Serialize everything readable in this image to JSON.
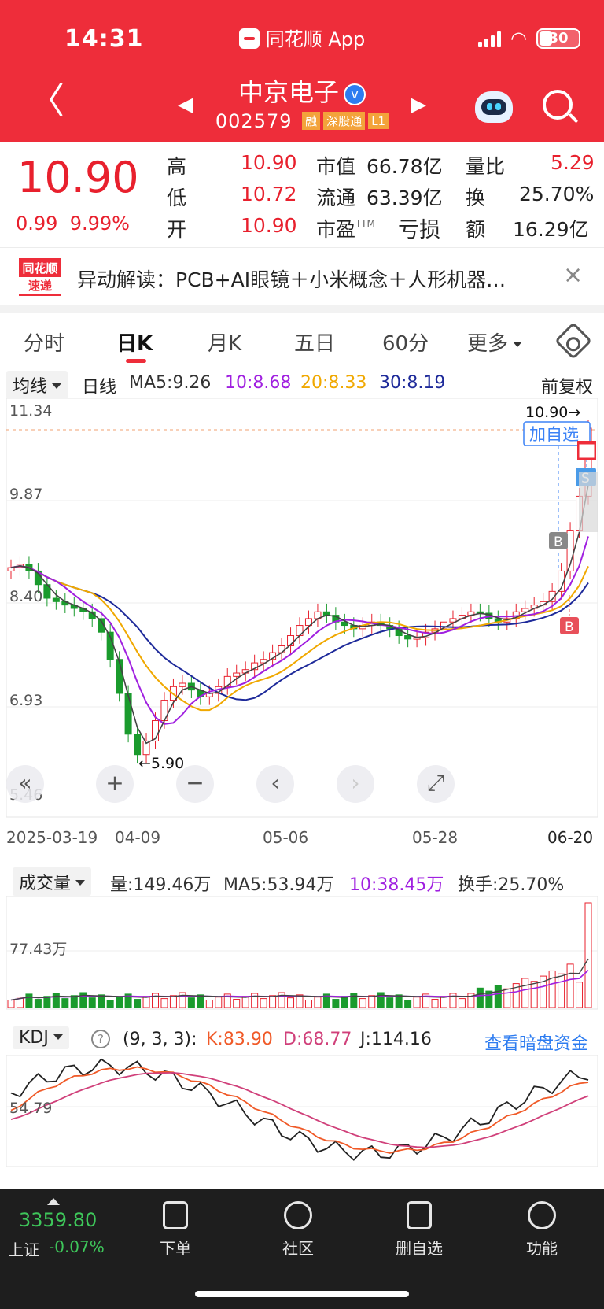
{
  "status": {
    "time": "14:31",
    "app": "同花顺 App",
    "battery": "30"
  },
  "header": {
    "name": "中京电子",
    "verified_mark": "v",
    "code": "002579",
    "tags": [
      "融",
      "深股通",
      "L1"
    ]
  },
  "quote": {
    "price": "10.90",
    "change": "0.99",
    "change_pct": "9.99%",
    "high_label": "高",
    "high": "10.90",
    "low_label": "低",
    "low": "10.72",
    "open_label": "开",
    "open": "10.90",
    "mktcap_label": "市值",
    "mktcap": "66.78亿",
    "float_label": "流通",
    "float": "63.39亿",
    "pe_label": "市盈",
    "pe_sup": "TTM",
    "pe": "亏损",
    "volratio_label": "量比",
    "volratio": "5.29",
    "turnover_label": "换",
    "turnover": "25.70%",
    "amount_label": "额",
    "amount": "16.29亿"
  },
  "news": {
    "badge_top": "同花顺",
    "badge_bottom": "速递",
    "text": "异动解读：PCB+AI眼镜＋小米概念＋人形机器…",
    "close": "×"
  },
  "tabs": [
    "分时",
    "日K",
    "月K",
    "五日",
    "60分",
    "更多"
  ],
  "ma_legend": {
    "selector": "均线",
    "period": "日线",
    "ma5": "MA5:9.26",
    "ma10": "10:8.68",
    "ma20": "20:8.33",
    "ma30": "30:8.19",
    "adjust": "前复权"
  },
  "kline": {
    "y_labels": [
      "11.34",
      "9.87",
      "8.40",
      "6.93",
      "5.46"
    ],
    "last_price_label": "10.90→",
    "add_watch": "加自选",
    "low_marker": "←5.90",
    "dates": [
      "2025-03-19",
      "04-09",
      "05-06",
      "05-28",
      "06-20"
    ],
    "markers": [
      "B",
      "S",
      "B"
    ],
    "controls": [
      "«",
      "+",
      "−",
      "‹",
      "›",
      "⤢"
    ]
  },
  "volume": {
    "selector": "成交量",
    "vol": "量:149.46万",
    "ma5": "MA5:53.94万",
    "ma10": "10:38.45万",
    "turnover": "换手:25.70%",
    "y_label": "77.43万"
  },
  "kdj": {
    "selector": "KDJ",
    "help": "?",
    "params": "(9, 3, 3):",
    "k": "K:83.90",
    "d": "D:68.77",
    "j": "J:114.16",
    "link": "查看暗盘资金",
    "y_label": "54.79"
  },
  "bottom": {
    "index_value": "3359.80",
    "index_name": "上证",
    "index_change": "-0.07%",
    "nav": [
      "下单",
      "社区",
      "删自选",
      "功能"
    ]
  },
  "colors": {
    "brand_red": "#ee2d3a",
    "up_red": "#e8202d",
    "down_green": "#1a9b2d",
    "ma5": "#333333",
    "ma10": "#a020e0",
    "ma20": "#f0a800",
    "ma30": "#1e2a9a"
  }
}
